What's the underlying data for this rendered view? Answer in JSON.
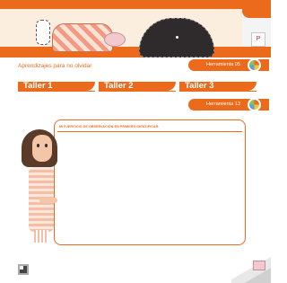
{
  "header": {
    "card_label": "P"
  },
  "section": {
    "aprendizajes_title": "Aprendizajes para no olvidar",
    "herramienta_top": "Herramienta 05",
    "herramienta_bottom": "Herramienta 13"
  },
  "tabs": [
    {
      "label": "Taller 1"
    },
    {
      "label": "Taller 2"
    },
    {
      "label": "Taller 3"
    }
  ],
  "exercise": {
    "title": "MI EJERCICIO DE OBSERVACIÓN EN PRIMERO IDENTIFICAR:"
  },
  "colors": {
    "accent": "#ec6a1c",
    "cream": "#fbeede"
  }
}
